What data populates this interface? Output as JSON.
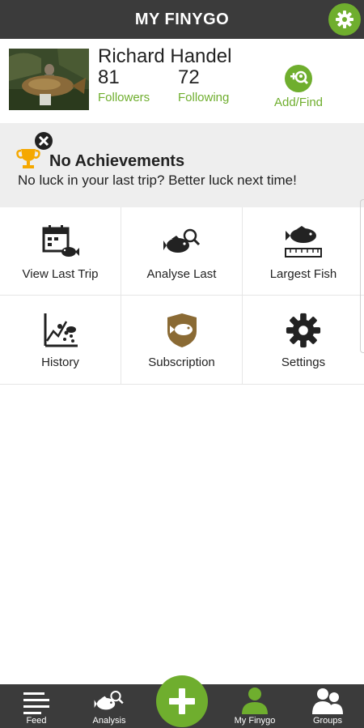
{
  "header": {
    "title": "MY FINYGO",
    "settings_icon": "gear-icon"
  },
  "profile": {
    "name": "Richard Handel",
    "followers_count": "81",
    "followers_label": "Followers",
    "following_count": "72",
    "following_label": "Following",
    "add_find_label": "Add/Find"
  },
  "achievements": {
    "title": "No Achievements",
    "subtitle": "No luck in your last trip? Better luck next time!"
  },
  "tiles": [
    {
      "label": "View Last Trip",
      "icon": "calendar-fish-icon"
    },
    {
      "label": "Analyse Last",
      "icon": "fish-magnifier-icon"
    },
    {
      "label": "Largest Fish",
      "icon": "fish-ruler-icon"
    },
    {
      "label": "History",
      "icon": "chart-history-icon"
    },
    {
      "label": "Subscription",
      "icon": "fish-shield-icon"
    },
    {
      "label": "Settings",
      "icon": "gear-icon"
    }
  ],
  "bottom_nav": {
    "items": [
      {
        "label": "Feed",
        "icon": "lines-icon"
      },
      {
        "label": "Analysis",
        "icon": "fish-magnifier-icon"
      },
      {
        "label": "My Finygo",
        "icon": "person-icon"
      },
      {
        "label": "Groups",
        "icon": "group-icon"
      }
    ],
    "add_icon": "plus-icon"
  },
  "colors": {
    "accent": "#6fae2e",
    "header": "#3b3b3b",
    "achievement_bg": "#eeeeee",
    "trophy": "#f5a800"
  }
}
